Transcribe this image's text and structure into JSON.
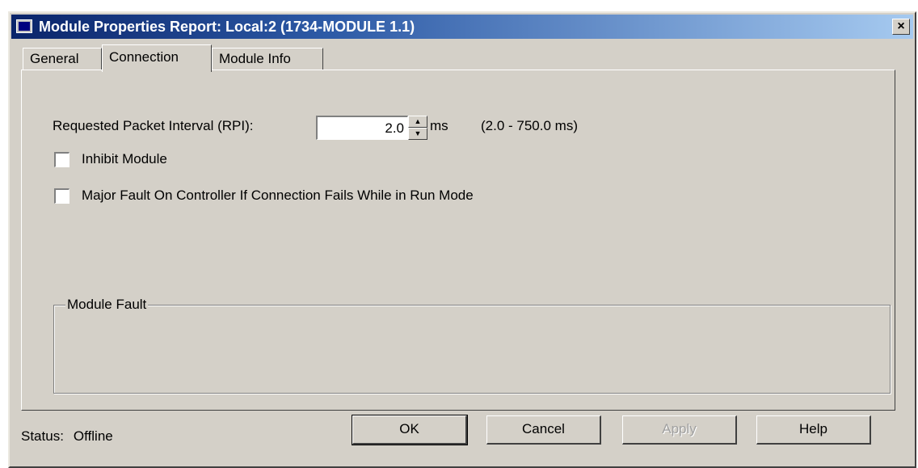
{
  "window": {
    "title": "Module Properties Report: Local:2 (1734-MODULE 1.1)",
    "close_glyph": "×"
  },
  "tabs": [
    {
      "label": "General",
      "selected": false
    },
    {
      "label": "Connection",
      "selected": true
    },
    {
      "label": "Module Info",
      "selected": false
    }
  ],
  "connection": {
    "rpi_label": "Requested Packet Interval (RPI):",
    "rpi_value": "2.0",
    "rpi_unit": "ms",
    "rpi_range": "(2.0 - 750.0 ms)",
    "inhibit_label": "Inhibit Module",
    "inhibit_checked": false,
    "major_fault_label": "Major Fault On Controller If Connection Fails While in Run Mode",
    "major_fault_checked": false,
    "module_fault_legend": "Module Fault"
  },
  "status": {
    "label": "Status:",
    "value": "Offline"
  },
  "buttons": {
    "ok": "OK",
    "cancel": "Cancel",
    "apply": "Apply",
    "help": "Help"
  },
  "colors": {
    "dialog_face": "#d4d0c8",
    "title_active": "#0a246a",
    "title_gradient_end": "#a6caf0",
    "disabled_text": "#a0a0a0"
  }
}
